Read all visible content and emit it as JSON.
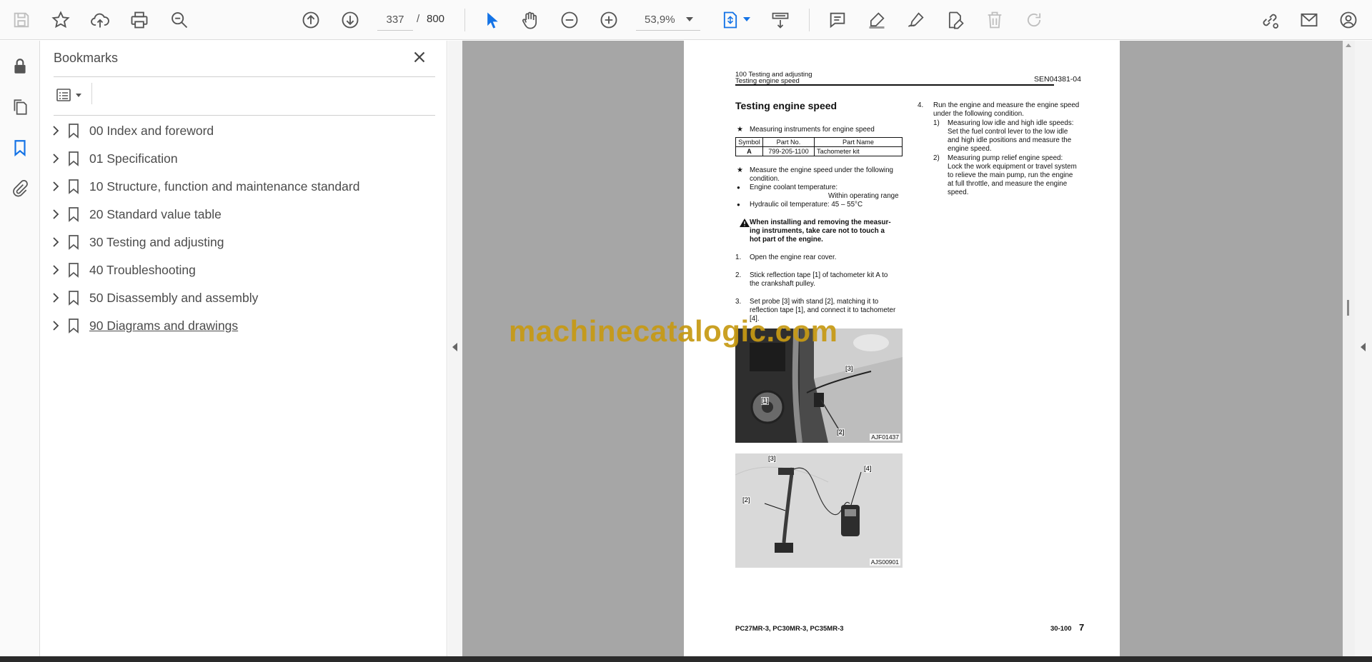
{
  "toolbar": {
    "page_current": "337",
    "page_separator": "/",
    "page_total": "800",
    "zoom": "53,9%"
  },
  "bookmarks_panel": {
    "title": "Bookmarks",
    "items": [
      {
        "label": "00 Index and foreword"
      },
      {
        "label": "01 Specification"
      },
      {
        "label": "10 Structure, function and maintenance standard"
      },
      {
        "label": "20 Standard value table"
      },
      {
        "label": "30 Testing and adjusting"
      },
      {
        "label": "40 Troubleshooting"
      },
      {
        "label": "50 Disassembly and assembly"
      },
      {
        "label": "90 Diagrams and drawings"
      }
    ]
  },
  "document": {
    "header_line1": "100 Testing and adjusting",
    "header_line2": "Testing engine speed",
    "header_code": "SEN04381-04",
    "section_title": "Testing engine speed",
    "star": "★",
    "bullet": "●",
    "instruments_note": "Measuring instruments for engine speed",
    "table": {
      "headers": [
        "Symbol",
        "Part No.",
        "Part Name"
      ],
      "row": [
        "A",
        "799-205-1100",
        "Tachometer kit"
      ]
    },
    "cond_line1": "Measure the engine speed under the following",
    "cond_line2": "condition.",
    "coolant_label": "Engine coolant temperature:",
    "coolant_value": "Within operating range",
    "hydraulic": "Hydraulic oil temperature: 45 – 55°C",
    "warn_line1": "When installing and removing the measur-",
    "warn_line2": "ing instruments, take care not to touch a",
    "warn_line3": "hot part of the engine.",
    "step1_num": "1.",
    "step1": "Open the engine rear cover.",
    "step2_num": "2.",
    "step2_line1": "Stick reflection tape [1] of tachometer kit A to",
    "step2_line2": "the crankshaft pulley.",
    "step3_num": "3.",
    "step3_line1": "Set probe [3] with stand [2], matching it to",
    "step3_line2": "reflection tape [1], and connect it to tachometer",
    "step3_line3": "[4].",
    "photo1_code": "AJF01437",
    "photo1_callouts": [
      "[3]",
      "[1]",
      "[2]"
    ],
    "photo2_code": "AJS00901",
    "photo2_callouts": [
      "[3]",
      "[4]",
      "[2]"
    ],
    "step4_num": "4.",
    "step4_line1": "Run the engine and measure the engine speed",
    "step4_line2": "under the following condition.",
    "sub1_num": "1)",
    "sub1_title": "Measuring low idle and high idle speeds:",
    "sub1_line1": "Set the fuel control lever to the low idle",
    "sub1_line2": "and high idle positions and measure the",
    "sub1_line3": "engine speed.",
    "sub2_num": "2)",
    "sub2_title": "Measuring pump relief engine speed:",
    "sub2_line1": "Lock the work equipment or travel system",
    "sub2_line2": "to relieve the main pump, run the engine",
    "sub2_line3": "at full throttle, and measure the engine",
    "sub2_line4": "speed.",
    "footer_models": "PC27MR-3, PC30MR-3, PC35MR-3",
    "footer_code": "30-100",
    "footer_page": "7"
  },
  "watermark": "machinecatalogic.com",
  "colors": {
    "accent": "#1473e6",
    "watermark": "#c79a14",
    "doc_background": "#a6a6a6"
  }
}
